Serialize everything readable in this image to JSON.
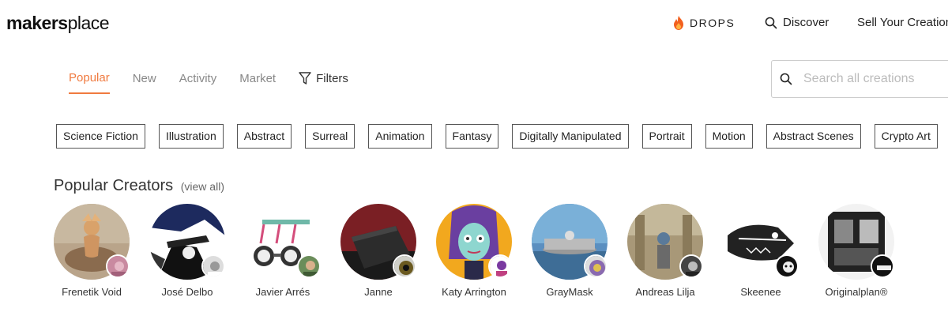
{
  "header": {
    "logo_bold": "makers",
    "logo_light": "place",
    "drops_label": "DROPS",
    "discover_label": "Discover",
    "sell_label": "Sell Your Creations"
  },
  "tabs": [
    {
      "label": "Popular",
      "active": true
    },
    {
      "label": "New"
    },
    {
      "label": "Activity"
    },
    {
      "label": "Market"
    }
  ],
  "filters_label": "Filters",
  "search": {
    "placeholder": "Search all creations"
  },
  "chips": [
    "Science Fiction",
    "Illustration",
    "Abstract",
    "Surreal",
    "Animation",
    "Fantasy",
    "Digitally Manipulated",
    "Portrait",
    "Motion",
    "Abstract Scenes",
    "Crypto Art"
  ],
  "section": {
    "title": "Popular Creators",
    "view_all": "(view all)"
  },
  "creators": [
    {
      "name": "Frenetik Void"
    },
    {
      "name": "José Delbo"
    },
    {
      "name": "Javier Arrés"
    },
    {
      "name": "Janne"
    },
    {
      "name": "Katy Arrington"
    },
    {
      "name": "GrayMask"
    },
    {
      "name": "Andreas Lilja"
    },
    {
      "name": "Skeenee"
    },
    {
      "name": "Originalplan®"
    }
  ],
  "colors": {
    "accent": "#f07a3f",
    "chip_border": "#555555"
  }
}
